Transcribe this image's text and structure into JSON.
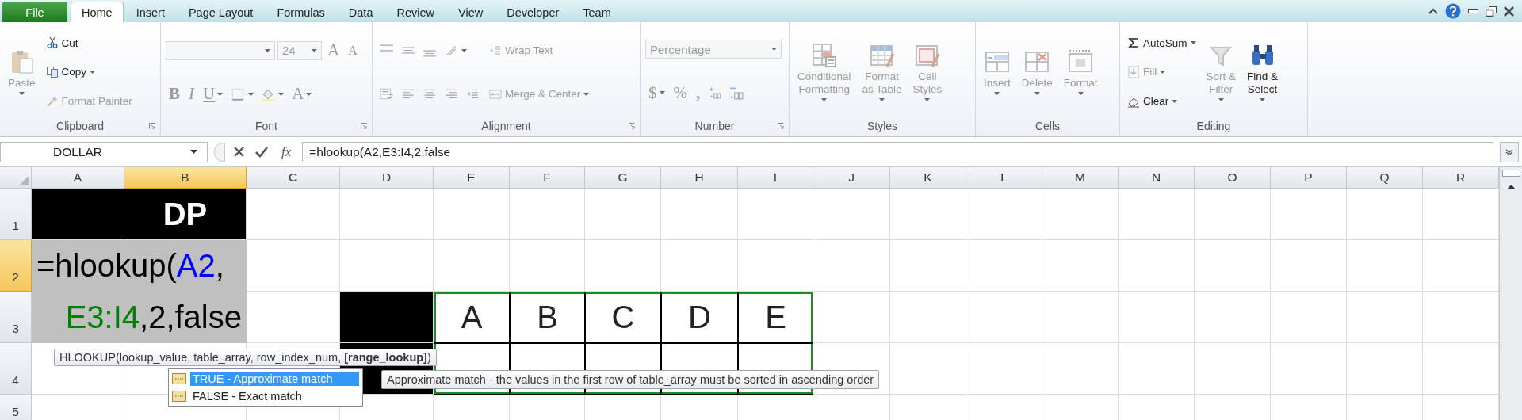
{
  "tabs": [
    {
      "label": "File",
      "kind": "file",
      "selected": false
    },
    {
      "label": "Home",
      "kind": "tab",
      "selected": true
    },
    {
      "label": "Insert",
      "kind": "tab",
      "selected": false
    },
    {
      "label": "Page Layout",
      "kind": "tab",
      "selected": false
    },
    {
      "label": "Formulas",
      "kind": "tab",
      "selected": false
    },
    {
      "label": "Data",
      "kind": "tab",
      "selected": false
    },
    {
      "label": "Review",
      "kind": "tab",
      "selected": false
    },
    {
      "label": "View",
      "kind": "tab",
      "selected": false
    },
    {
      "label": "Developer",
      "kind": "tab",
      "selected": false
    },
    {
      "label": "Team",
      "kind": "tab",
      "selected": false
    }
  ],
  "ribbon": {
    "groups": [
      {
        "label": "Clipboard",
        "launcher": true,
        "columns": [
          [
            {
              "kind": "large",
              "label": "Paste",
              "menu": true,
              "disabled": true
            }
          ],
          [
            {
              "kind": "small",
              "label": "Cut",
              "disabled": false
            },
            {
              "kind": "small",
              "label": "Copy",
              "menu": true,
              "disabled": false
            },
            {
              "kind": "small",
              "label": "Format Painter",
              "disabled": true
            }
          ]
        ]
      },
      {
        "label": "Font",
        "launcher": true,
        "columns": [
          [
            {
              "kind": "row",
              "items": [
                {
                  "kind": "field",
                  "menu": true,
                  "disabled": true
                },
                {
                  "kind": "field",
                  "value": "24",
                  "menu": true,
                  "disabled": true
                },
                {
                  "kind": "glyph",
                  "label": "A",
                  "disabled": true
                },
                {
                  "kind": "glyph",
                  "label": "A",
                  "disabled": true
                }
              ]
            },
            {
              "kind": "row",
              "items": [
                {
                  "kind": "glyph",
                  "label": "B",
                  "disabled": true
                },
                {
                  "kind": "glyph",
                  "label": "I",
                  "disabled": true
                },
                {
                  "kind": "glyph",
                  "label": "U",
                  "menu": true,
                  "disabled": true
                },
                {
                  "kind": "icon",
                  "menu": true,
                  "disabled": true
                },
                {
                  "kind": "icon",
                  "menu": true,
                  "disabled": true
                },
                {
                  "kind": "glyph",
                  "label": "A",
                  "menu": true,
                  "disabled": true
                }
              ]
            }
          ]
        ]
      },
      {
        "label": "Alignment",
        "launcher": true,
        "columns": [
          [
            {
              "kind": "row",
              "items": [
                {
                  "kind": "icon",
                  "disabled": true
                },
                {
                  "kind": "icon",
                  "disabled": true
                },
                {
                  "kind": "icon",
                  "disabled": true
                },
                {
                  "kind": "icon",
                  "menu": true,
                  "disabled": true
                }
              ]
            },
            {
              "kind": "row",
              "items": [
                {
                  "kind": "icon",
                  "disabled": true
                },
                {
                  "kind": "icon",
                  "disabled": true
                },
                {
                  "kind": "icon",
                  "disabled": true
                },
                {
                  "kind": "icon",
                  "disabled": true
                },
                {
                  "kind": "icon",
                  "disabled": true
                }
              ]
            }
          ],
          [
            {
              "kind": "small",
              "label": "Wrap Text",
              "disabled": true
            },
            {
              "kind": "small",
              "label": "Merge & Center",
              "menu": true,
              "disabled": true
            }
          ]
        ]
      },
      {
        "label": "Number",
        "launcher": true,
        "columns": [
          [
            {
              "kind": "row",
              "items": [
                {
                  "kind": "field",
                  "value": "Percentage",
                  "menu": true,
                  "disabled": true
                }
              ]
            },
            {
              "kind": "row",
              "items": [
                {
                  "kind": "glyph",
                  "label": "$",
                  "menu": true,
                  "disabled": true
                },
                {
                  "kind": "glyph",
                  "label": "%",
                  "disabled": true
                },
                {
                  "kind": "glyph",
                  "label": ",",
                  "disabled": true
                },
                {
                  "kind": "icon",
                  "disabled": true
                },
                {
                  "kind": "icon",
                  "disabled": true
                }
              ]
            }
          ]
        ]
      },
      {
        "label": "Styles",
        "columns": [
          [
            {
              "kind": "large",
              "label": "Conditional\nFormatting",
              "menu": true,
              "disabled": true
            }
          ],
          [
            {
              "kind": "large",
              "label": "Format\nas Table",
              "menu": true,
              "disabled": true
            }
          ],
          [
            {
              "kind": "large",
              "label": "Cell\nStyles",
              "menu": true,
              "disabled": true
            }
          ]
        ]
      },
      {
        "label": "Cells",
        "columns": [
          [
            {
              "kind": "large",
              "label": "Insert",
              "menu": true,
              "disabled": true
            }
          ],
          [
            {
              "kind": "large",
              "label": "Delete",
              "menu": true,
              "disabled": true
            }
          ],
          [
            {
              "kind": "large",
              "label": "Format",
              "menu": true,
              "disabled": true
            }
          ]
        ]
      },
      {
        "label": "Editing",
        "columns": [
          [
            {
              "kind": "small",
              "label": "AutoSum",
              "menu": true,
              "disabled": false
            },
            {
              "kind": "small",
              "label": "Fill",
              "menu": true,
              "disabled": true
            },
            {
              "kind": "small",
              "label": "Clear",
              "menu": true,
              "disabled": false
            }
          ],
          [
            {
              "kind": "large",
              "label": "Sort &\nFilter",
              "menu": true,
              "disabled": true
            }
          ],
          [
            {
              "kind": "large",
              "label": "Find &\nSelect",
              "menu": true,
              "disabled": false
            }
          ]
        ]
      }
    ]
  },
  "formula_bar": {
    "name_box": "DOLLAR",
    "function_label": "fx",
    "formula": "=hlookup(A2,E3:I4,2,false"
  },
  "sheet": {
    "columns": [
      {
        "label": "A",
        "selected": false
      },
      {
        "label": "B",
        "selected": true
      },
      {
        "label": "C",
        "selected": false
      },
      {
        "label": "D",
        "selected": false
      },
      {
        "label": "E",
        "selected": false
      },
      {
        "label": "F",
        "selected": false
      },
      {
        "label": "G",
        "selected": false
      },
      {
        "label": "H",
        "selected": false
      },
      {
        "label": "I",
        "selected": false
      },
      {
        "label": "J",
        "selected": false
      },
      {
        "label": "K",
        "selected": false
      },
      {
        "label": "L",
        "selected": false
      },
      {
        "label": "M",
        "selected": false
      },
      {
        "label": "N",
        "selected": false
      },
      {
        "label": "O",
        "selected": false
      },
      {
        "label": "P",
        "selected": false
      },
      {
        "label": "Q",
        "selected": false
      },
      {
        "label": "R",
        "selected": false
      }
    ],
    "rows": [
      {
        "label": "1",
        "selected": false,
        "cells": [
          {
            "color": "#000000"
          },
          {
            "text": "DP",
            "bold": true,
            "color": "#000000"
          }
        ]
      },
      {
        "label": "2",
        "selected": true,
        "cells": [
          {
            "editing": true
          },
          {
            "editing": true
          }
        ]
      },
      {
        "label": "3",
        "selected": false,
        "cells": [
          {
            "editing": true
          },
          {
            "editing": true
          },
          {},
          {
            "color": "#000000"
          },
          {
            "text": "A",
            "boxed": true,
            "reference": true
          },
          {
            "text": "B",
            "boxed": true,
            "reference": true
          },
          {
            "text": "C",
            "boxed": true,
            "reference": true
          },
          {
            "text": "D",
            "boxed": true,
            "reference": true
          },
          {
            "text": "E",
            "boxed": true,
            "reference": true
          }
        ]
      },
      {
        "label": "4",
        "selected": false,
        "cells": [
          {},
          {},
          {},
          {
            "color": "#000000"
          },
          {
            "boxed": true,
            "reference": true
          },
          {
            "boxed": true,
            "reference": true
          },
          {
            "boxed": true,
            "reference": true
          },
          {
            "boxed": true,
            "reference": true
          },
          {
            "boxed": true,
            "reference": true
          }
        ]
      },
      {
        "label": "5",
        "selected": false,
        "cells": []
      }
    ],
    "editor": {
      "lines": [
        [
          {
            "text": "=hlookup("
          },
          {
            "text": "A2",
            "color": "#0000ff"
          },
          {
            "text": ","
          }
        ],
        [
          {
            "text": "E3:I4",
            "color": "#008000"
          },
          {
            "text": ",2,false"
          }
        ]
      ]
    }
  },
  "autocomplete": {
    "hint": "HLOOKUP(lookup_value, table_array, row_index_num, **[range_lookup]**)",
    "items": [
      {
        "label": "TRUE - Approximate match",
        "selected": true
      },
      {
        "label": "FALSE - Exact match",
        "selected": false
      }
    ],
    "description": "Approximate match - the values in the first row of table_array must be sorted in ascending order"
  }
}
